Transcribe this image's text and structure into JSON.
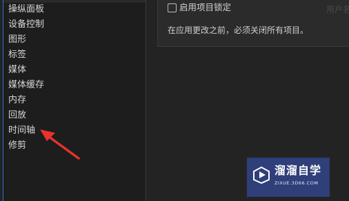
{
  "sidebar": {
    "items": [
      {
        "label": "操纵面板"
      },
      {
        "label": "设备控制"
      },
      {
        "label": "图形"
      },
      {
        "label": "标签"
      },
      {
        "label": "媒体"
      },
      {
        "label": "媒体缓存"
      },
      {
        "label": "内存"
      },
      {
        "label": "回放"
      },
      {
        "label": "时间轴"
      },
      {
        "label": "修剪"
      }
    ]
  },
  "main": {
    "project_lock_checkbox": {
      "label": "启用项目锁定",
      "checked": false
    },
    "faded_label": "用户名",
    "note": "在应用更改之前，必须关闭所有项目。"
  },
  "annotation": {
    "arrow_color": "#e8322b"
  },
  "watermark": {
    "title": "溜溜自学",
    "url": "ZIXUE.3D66.COM"
  }
}
